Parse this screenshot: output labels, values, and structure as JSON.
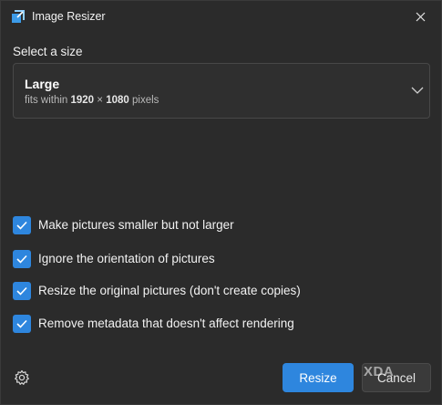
{
  "window": {
    "title": "Image Resizer",
    "accent_color": "#2e86de",
    "background_color": "#2b2b2b"
  },
  "size_section": {
    "label": "Select a size",
    "selected": {
      "name": "Large",
      "desc_prefix": "fits within",
      "width": "1920",
      "times": "×",
      "height": "1080",
      "unit": "pixels"
    }
  },
  "options": [
    {
      "label": "Make pictures smaller but not larger",
      "checked": true
    },
    {
      "label": "Ignore the orientation of pictures",
      "checked": true
    },
    {
      "label": "Resize the original pictures (don't create copies)",
      "checked": true
    },
    {
      "label": "Remove metadata that doesn't affect rendering",
      "checked": true
    }
  ],
  "footer": {
    "resize_label": "Resize",
    "cancel_label": "Cancel",
    "settings_icon": "gear-icon"
  },
  "watermark": "XDA"
}
